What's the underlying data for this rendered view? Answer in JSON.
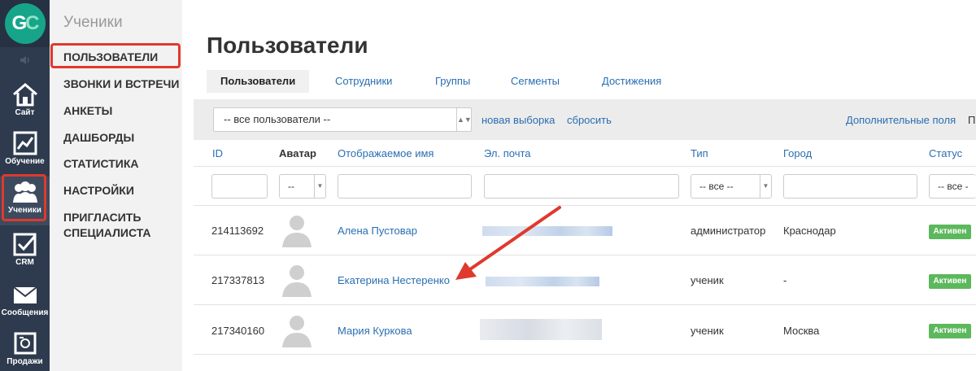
{
  "logo": {
    "g": "G",
    "c": "C"
  },
  "rail": {
    "items": [
      {
        "label": "Сайт",
        "icon": "home-icon"
      },
      {
        "label": "Обучение",
        "icon": "chart-icon"
      },
      {
        "label": "Ученики",
        "icon": "users-icon"
      },
      {
        "label": "CRM",
        "icon": "checkbox-icon"
      },
      {
        "label": "Сообщения",
        "icon": "envelope-icon"
      },
      {
        "label": "Продажи",
        "icon": "register-icon"
      }
    ]
  },
  "submenu": {
    "title": "Ученики",
    "items": [
      "ПОЛЬЗОВАТЕЛИ",
      "ЗВОНКИ И ВСТРЕЧИ",
      "АНКЕТЫ",
      "ДАШБОРДЫ",
      "СТАТИСТИКА",
      "НАСТРОЙКИ",
      "ПРИГЛАСИТЬ",
      "СПЕЦИАЛИСТА"
    ]
  },
  "page": {
    "title": "Пользователи",
    "tabs": [
      "Пользователи",
      "Сотрудники",
      "Группы",
      "Сегменты",
      "Достижения"
    ]
  },
  "filters": {
    "segment_value": "-- все пользователи --",
    "new_selection": "новая выборка",
    "reset": "сбросить",
    "extra_fields": "Дополнительные поля",
    "extra_cut": "П"
  },
  "table": {
    "headers": {
      "id": "ID",
      "avatar": "Аватар",
      "name": "Отображаемое имя",
      "email": "Эл. почта",
      "type": "Тип",
      "city": "Город",
      "status": "Статус"
    },
    "filter_values": {
      "avatar": "--",
      "type": "-- все --",
      "status": "-- все -"
    },
    "rows": [
      {
        "id": "214113692",
        "name": "Алена Пустовар",
        "type": "администратор",
        "city": "Краснодар",
        "status": "Активен"
      },
      {
        "id": "217337813",
        "name": "Екатерина Нестеренко",
        "type": "ученик",
        "city": "-",
        "status": "Активен"
      },
      {
        "id": "217340160",
        "name": "Мария Куркова",
        "type": "ученик",
        "city": "Москва",
        "status": "Активен"
      }
    ]
  },
  "colors": {
    "accent": "#2a6eb2",
    "highlight": "#e0392d",
    "badge": "#5cb85c",
    "rail": "#2e3b4e"
  }
}
